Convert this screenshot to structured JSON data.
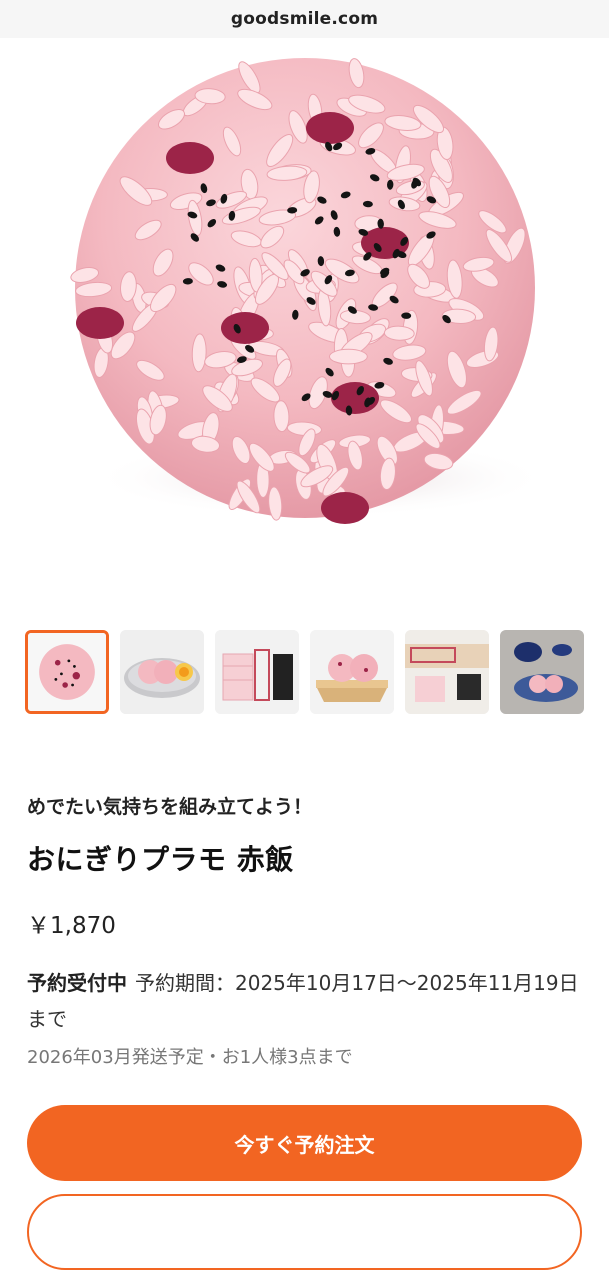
{
  "browser": {
    "url": "goodsmile.com"
  },
  "product": {
    "tagline": "めでたい気持ちを組み立てよう！",
    "title": "おにぎりプラモ 赤飯",
    "price": "￥1,870",
    "status": "予約受付中",
    "period": "予約期間：2025年10月17日～2025年11月19日まで",
    "note": "2026年03月発送予定・お1人様3点まで"
  },
  "gallery": {
    "thumbnails": [
      "rice-ball",
      "plate-with-egg",
      "runner-parts",
      "board-with-rice-balls",
      "assembly-parts",
      "teapot-and-plate"
    ],
    "selected_index": 0
  },
  "actions": {
    "order_label": "今すぐ予約注文"
  },
  "colors": {
    "accent": "#f26522",
    "rice": "#f6c2c9",
    "bean": "#9c2448",
    "sesame": "#141414"
  }
}
